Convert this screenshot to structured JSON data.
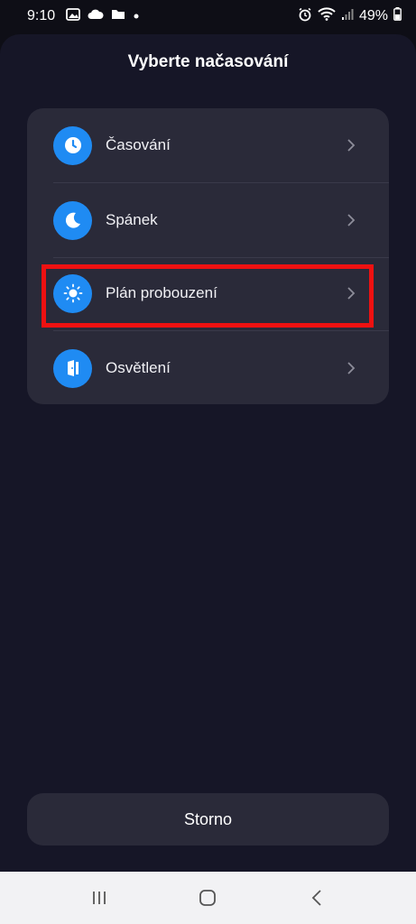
{
  "status_bar": {
    "time": "9:10",
    "battery": "49%",
    "icons_left": [
      "gallery-icon",
      "cloud-icon",
      "folder-icon",
      "dot-icon"
    ],
    "icons_right": [
      "alarm-icon",
      "wifi-icon",
      "signal-icon",
      "battery-icon"
    ]
  },
  "sheet": {
    "title": "Vyberte načasování",
    "items": [
      {
        "label": "Časování",
        "icon": "clock-icon"
      },
      {
        "label": "Spánek",
        "icon": "moon-icon"
      },
      {
        "label": "Plán probouzení",
        "icon": "sun-icon",
        "highlighted": true
      },
      {
        "label": "Osvětlení",
        "icon": "door-light-icon"
      }
    ],
    "cancel_label": "Storno"
  },
  "navigation_bar": {
    "buttons": [
      "recent-apps-icon",
      "home-icon",
      "back-icon"
    ]
  },
  "colors": {
    "accent": "#1f8bf3",
    "sheet_background": "#161627",
    "card_background": "#2a2a39",
    "highlight": "#ee1111"
  }
}
